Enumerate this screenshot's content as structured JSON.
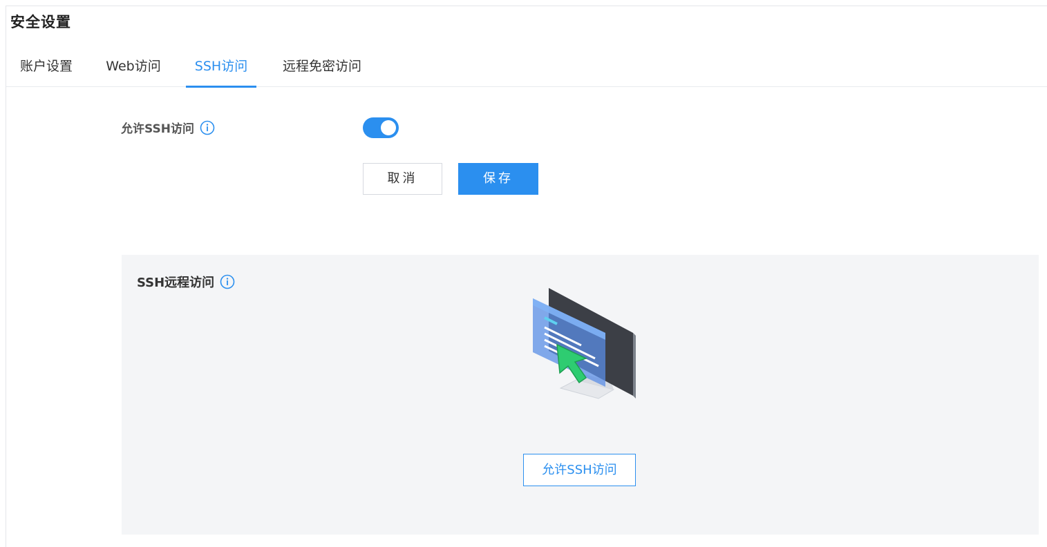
{
  "page": {
    "title": "安全设置"
  },
  "tabs": [
    {
      "label": "账户设置",
      "active": false
    },
    {
      "label": "Web访问",
      "active": false
    },
    {
      "label": "SSH访问",
      "active": true
    },
    {
      "label": "远程免密访问",
      "active": false
    }
  ],
  "settings": {
    "allow_ssh_label": "允许SSH访问",
    "allow_ssh_enabled": true,
    "cancel_label": "取消",
    "save_label": "保存"
  },
  "panel": {
    "title": "SSH远程访问",
    "enable_button_label": "允许SSH访问"
  },
  "colors": {
    "accent": "#2b8fef",
    "panel_bg": "#f4f5f7",
    "text": "#333333"
  },
  "icons": {
    "info": "info-circle-icon",
    "illustration": "monitor-cursor-illustration"
  }
}
